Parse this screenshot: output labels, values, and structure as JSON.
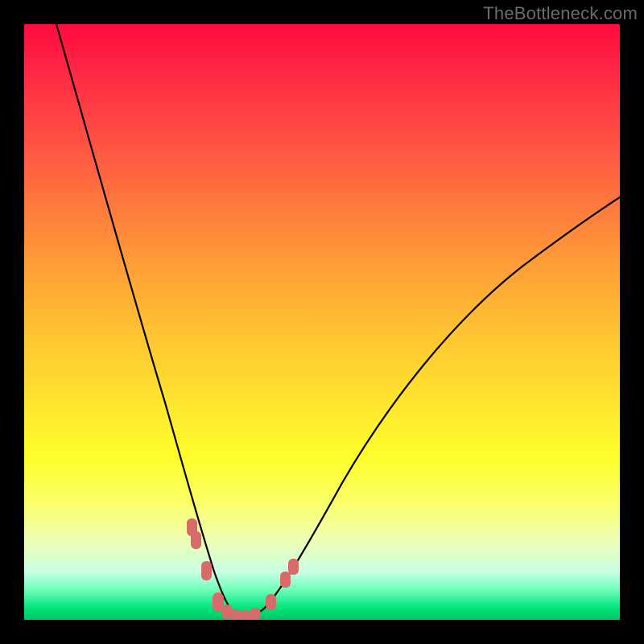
{
  "watermark": "TheBottleneck.com",
  "colors": {
    "frame": "#000000",
    "curve": "#000000",
    "marker": "#d96a6a",
    "watermark_text": "#6b6b6b"
  },
  "chart_data": {
    "type": "line",
    "title": "",
    "xlabel": "",
    "ylabel": "",
    "xlim": [
      0,
      100
    ],
    "ylim": [
      0,
      100
    ],
    "grid": false,
    "legend": false,
    "background": "rainbow-gradient-red-top-green-bottom",
    "series": [
      {
        "name": "bottleneck-curve",
        "x": [
          5,
          10,
          15,
          19,
          22,
          25,
          27,
          29,
          30,
          31.5,
          33,
          34.5,
          36,
          38,
          40,
          44,
          50,
          57,
          65,
          75,
          85,
          95,
          100
        ],
        "values": [
          100,
          82,
          64,
          46,
          34,
          24,
          16,
          10,
          7,
          4,
          2,
          1,
          0.5,
          0.5,
          1.5,
          4,
          10,
          20,
          32,
          46,
          58,
          68,
          72
        ]
      }
    ],
    "markers": [
      {
        "x": 27.2,
        "y_pct_from_bottom": 16.2
      },
      {
        "x": 27.7,
        "y_pct_from_bottom": 14.5
      },
      {
        "x": 29.4,
        "y_pct_from_bottom": 9.0
      },
      {
        "x": 31.5,
        "y_pct_from_bottom": 3.5
      },
      {
        "x": 33.0,
        "y_pct_from_bottom": 1.5
      },
      {
        "x": 34.5,
        "y_pct_from_bottom": 0.7
      },
      {
        "x": 36.0,
        "y_pct_from_bottom": 0.5
      },
      {
        "x": 37.5,
        "y_pct_from_bottom": 0.7
      },
      {
        "x": 40.5,
        "y_pct_from_bottom": 2.8
      },
      {
        "x": 43.2,
        "y_pct_from_bottom": 6.8
      },
      {
        "x": 44.5,
        "y_pct_from_bottom": 9.2
      }
    ]
  }
}
